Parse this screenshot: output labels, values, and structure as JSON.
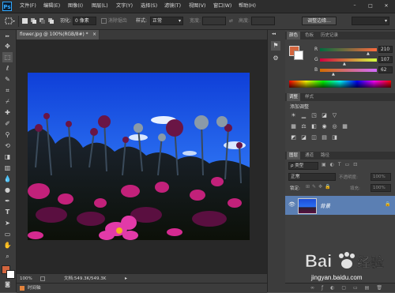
{
  "app": {
    "logo_text": "Ps"
  },
  "menu": [
    "文件(F)",
    "编辑(E)",
    "图像(I)",
    "图层(L)",
    "文字(Y)",
    "选择(S)",
    "滤镜(T)",
    "视图(V)",
    "窗口(W)",
    "帮助(H)"
  ],
  "window_controls": {
    "minimize": "–",
    "maximize": "□",
    "close": "✕"
  },
  "options_bar": {
    "feather_label": "羽化:",
    "feather_value": "0 像素",
    "antialias_label": "消除锯齿",
    "style_label": "样式:",
    "style_value": "正常",
    "width_label": "宽度:",
    "height_label": "高度:",
    "refine_button": "调整边缘..."
  },
  "document": {
    "tab_title": "flower.jpg @ 100%(RGB/8#) *",
    "close": "×"
  },
  "status": {
    "zoom": "100%",
    "doc_info": "文档:549.3K/549.3K"
  },
  "timeline": {
    "label": "时间轴"
  },
  "color_panel": {
    "tabs": [
      "颜色",
      "色板",
      "历史记录"
    ],
    "foreground_color": "#d2653e",
    "background_color": "#ffffff",
    "r": {
      "label": "R",
      "value": "210"
    },
    "g": {
      "label": "G",
      "value": "107"
    },
    "b": {
      "label": "B",
      "value": "62"
    }
  },
  "adjustments_panel": {
    "tabs": [
      "调整",
      "样式"
    ],
    "title": "添加调整",
    "icons": [
      "brightness-icon",
      "levels-icon",
      "curves-icon",
      "exposure-icon",
      "vibrance-icon",
      "hue-icon",
      "balance-icon",
      "bw-icon",
      "photo-filter-icon",
      "channel-mixer-icon",
      "lookup-icon",
      "invert-icon",
      "posterize-icon",
      "threshold-icon",
      "gradient-map-icon",
      "selective-color-icon"
    ]
  },
  "layers_panel": {
    "tabs": [
      "图层",
      "通道",
      "路径"
    ],
    "filter_label": "ρ 类型",
    "blend_mode": "正常",
    "opacity_label": "不透明度:",
    "opacity_value": "100%",
    "lock_label": "锁定:",
    "fill_label": "填充:",
    "fill_value": "100%",
    "layers": [
      {
        "name": "背景",
        "locked": true
      }
    ]
  },
  "watermark": {
    "brand": "Bai",
    "brand2": "经验",
    "url": "jingyan.baidu.com"
  }
}
